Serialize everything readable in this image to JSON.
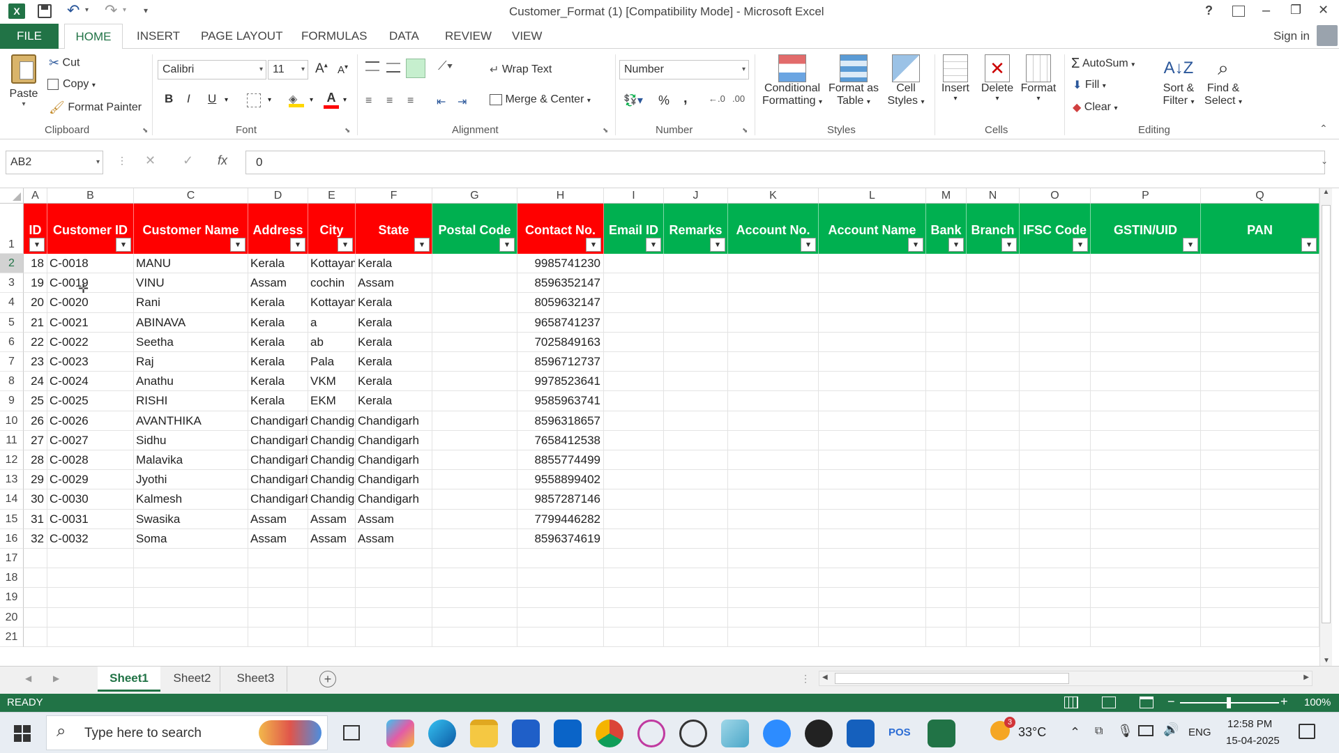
{
  "title_bar": {
    "title": "Customer_Format (1)  [Compatibility Mode] - Microsoft Excel",
    "help": "?",
    "minimize": "–",
    "restore": "❐",
    "close": "✕"
  },
  "quick_access": {
    "save_icon": "save-icon",
    "undo_icon": "undo-icon",
    "redo_icon": "redo-icon",
    "customize": "▾"
  },
  "tabs": [
    "FILE",
    "HOME",
    "INSERT",
    "PAGE LAYOUT",
    "FORMULAS",
    "DATA",
    "REVIEW",
    "VIEW"
  ],
  "sign_in": "Sign in",
  "ribbon": {
    "clipboard": {
      "paste": "Paste",
      "cut": "Cut",
      "copy": "Copy",
      "format_painter": "Format Painter",
      "label": "Clipboard"
    },
    "font": {
      "font_name": "Calibri",
      "font_size": "11",
      "bold": "B",
      "italic": "I",
      "underline": "U",
      "grow": "A",
      "shrink": "A",
      "label": "Font"
    },
    "alignment": {
      "wrap_text": "Wrap Text",
      "merge_center": "Merge & Center",
      "label": "Alignment"
    },
    "number": {
      "format": "Number",
      "percent": "%",
      "comma": ",",
      "label": "Number"
    },
    "styles": {
      "conditional_1": "Conditional",
      "conditional_2": "Formatting",
      "format_table_1": "Format as",
      "format_table_2": "Table",
      "cell_styles_1": "Cell",
      "cell_styles_2": "Styles",
      "label": "Styles"
    },
    "cells": {
      "insert": "Insert",
      "delete": "Delete",
      "format": "Format",
      "label": "Cells"
    },
    "editing": {
      "autosum": "AutoSum",
      "fill": "Fill",
      "clear": "Clear",
      "sort_1": "Sort &",
      "sort_2": "Filter",
      "find_1": "Find &",
      "find_2": "Select",
      "label": "Editing"
    }
  },
  "formula_bar": {
    "name_box": "AB2",
    "cancel": "✕",
    "enter": "✓",
    "fx": "fx",
    "value": "0"
  },
  "columns": [
    "A",
    "B",
    "C",
    "D",
    "E",
    "F",
    "G",
    "H",
    "I",
    "J",
    "K",
    "L",
    "M",
    "N",
    "O",
    "P",
    "Q"
  ],
  "headers": [
    "ID",
    "Customer ID",
    "Customer Name",
    "Address",
    "City",
    "State",
    "Postal Code",
    "Contact No.",
    "Email ID",
    "Remarks",
    "Account No.",
    "Account Name",
    "Bank",
    "Branch",
    "IFSC Code",
    "GSTIN/UID",
    "PAN"
  ],
  "header_colors": {
    "red": "#ff0000",
    "green": "#00b050"
  },
  "rows": [
    [
      "18",
      "C-0018",
      "MANU",
      "Kerala",
      "Kottayam",
      "Kerala",
      "",
      "9985741230"
    ],
    [
      "19",
      "C-0019",
      "VINU",
      "Assam",
      "cochin",
      "Assam",
      "",
      "8596352147"
    ],
    [
      "20",
      "C-0020",
      "Rani",
      "Kerala",
      "Kottayam",
      "Kerala",
      "",
      "8059632147"
    ],
    [
      "21",
      "C-0021",
      "ABINAVA",
      "Kerala",
      "a",
      "Kerala",
      "",
      "9658741237"
    ],
    [
      "22",
      "C-0022",
      "Seetha",
      "Kerala",
      "ab",
      "Kerala",
      "",
      "7025849163"
    ],
    [
      "23",
      "C-0023",
      "Raj",
      "Kerala",
      "Pala",
      "Kerala",
      "",
      "8596712737"
    ],
    [
      "24",
      "C-0024",
      "Anathu",
      "Kerala",
      "VKM",
      "Kerala",
      "",
      "9978523641"
    ],
    [
      "25",
      "C-0025",
      "RISHI",
      "Kerala",
      "EKM",
      "Kerala",
      "",
      "9585963741"
    ],
    [
      "26",
      "C-0026",
      "AVANTHIKA",
      "Chandigarh",
      "Chandigarh",
      "Chandigarh",
      "",
      "8596318657"
    ],
    [
      "27",
      "C-0027",
      "Sidhu",
      "Chandigarh",
      "Chandigarh",
      "Chandigarh",
      "",
      "7658412538"
    ],
    [
      "28",
      "C-0028",
      "Malavika",
      "Chandigarh",
      "Chandigarh",
      "Chandigarh",
      "",
      "8855774499"
    ],
    [
      "29",
      "C-0029",
      "Jyothi",
      "Chandigarh",
      "Chandigarh",
      "Chandigarh",
      "",
      "9558899402"
    ],
    [
      "30",
      "C-0030",
      "Kalmesh",
      "Chandigarh",
      "Chandigarh",
      "Chandigarh",
      "",
      "9857287146"
    ],
    [
      "31",
      "C-0031",
      "Swasika",
      "Assam",
      "Assam",
      "Assam",
      "",
      "7799446282"
    ],
    [
      "32",
      "C-0032",
      "Soma",
      "Assam",
      "Assam",
      "Assam",
      "",
      "8596374619"
    ]
  ],
  "row_numbers": [
    "1",
    "2",
    "3",
    "4",
    "5",
    "6",
    "7",
    "8",
    "9",
    "10",
    "11",
    "12",
    "13",
    "14",
    "15",
    "16",
    "17",
    "18",
    "19",
    "20",
    "21"
  ],
  "sheets": [
    "Sheet1",
    "Sheet2",
    "Sheet3"
  ],
  "active_sheet": "Sheet1",
  "status": {
    "ready": "READY",
    "zoom": "100%"
  },
  "taskbar": {
    "search_placeholder": "Type here to search",
    "temp": "33°C",
    "lang": "ENG",
    "time": "12:58 PM",
    "date": "15-04-2025",
    "weather_badge": "3",
    "pos_label": "POS"
  }
}
